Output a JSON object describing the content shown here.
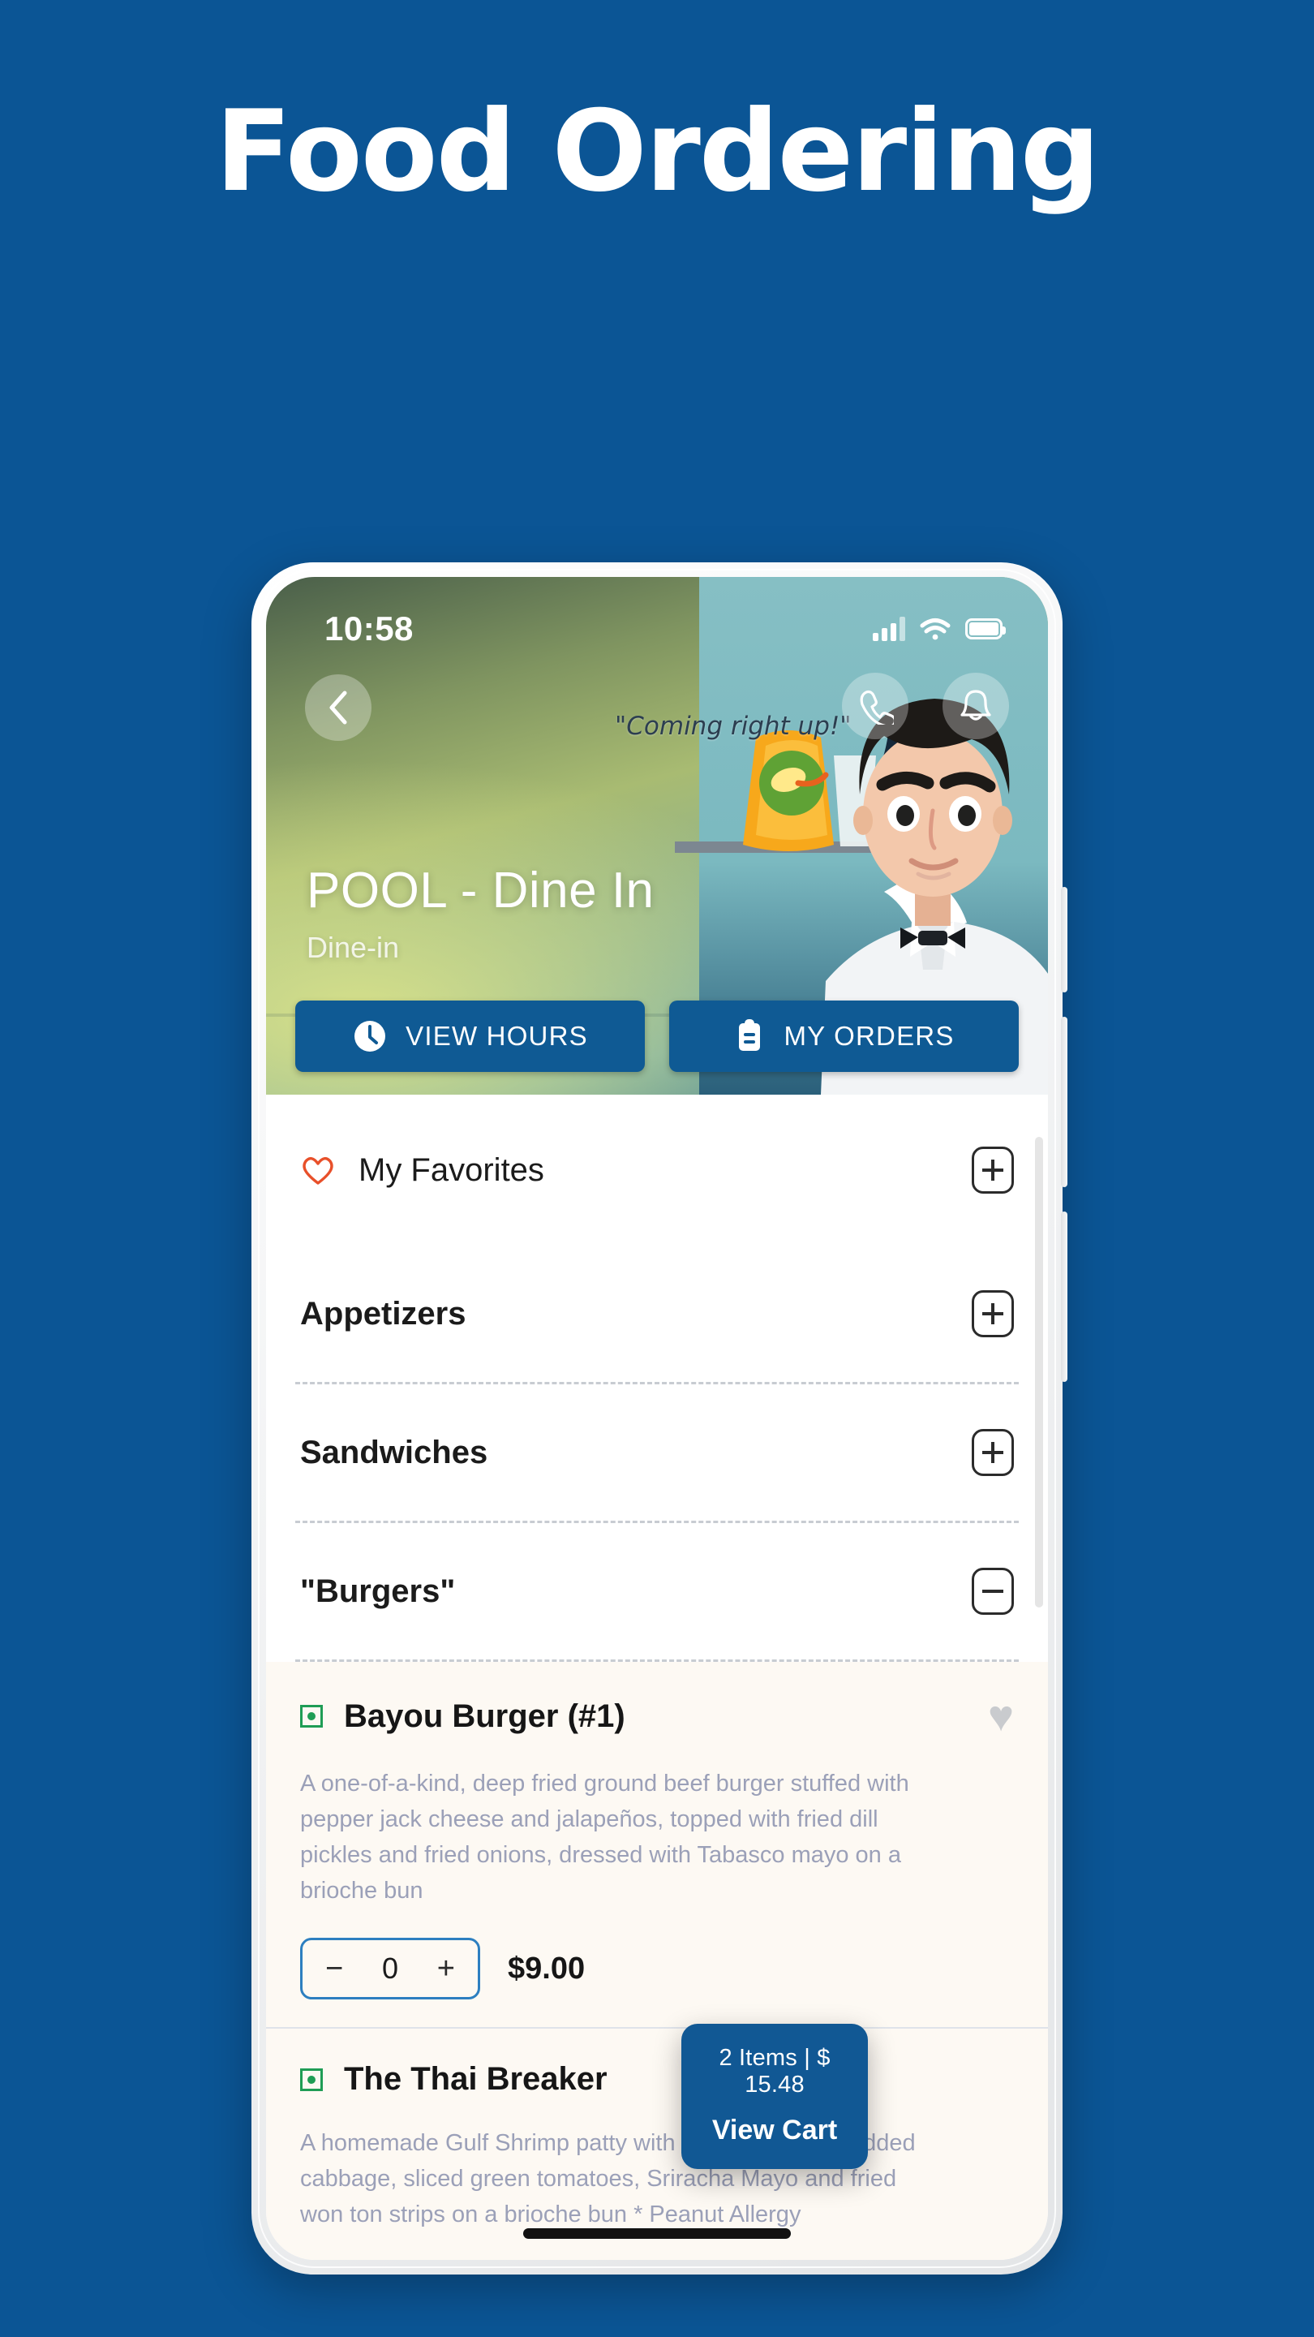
{
  "poster": {
    "title": "Food Ordering",
    "background_color": "#0b5595"
  },
  "phone": {
    "status_bar": {
      "time": "10:58",
      "signal_icon": "signal-bars-icon",
      "wifi_icon": "wifi-icon",
      "battery_icon": "battery-icon"
    }
  },
  "hero": {
    "back_icon": "chevron-left-icon",
    "phone_icon": "phone-icon",
    "bell_icon": "bell-icon",
    "speech_bubble": "\"Coming right up!\"",
    "title": "POOL - Dine In",
    "subtitle": "Dine-in",
    "buttons": [
      {
        "label": "VIEW HOURS",
        "icon": "clock-icon"
      },
      {
        "label": "MY ORDERS",
        "icon": "clipboard-icon"
      }
    ],
    "button_color": "#0f5a94"
  },
  "categories": [
    {
      "label": "My Favorites",
      "icon": "heart-outline-icon",
      "icon_color": "#e8502a",
      "bold": false,
      "state": "collapsed",
      "toggle": "plus"
    },
    {
      "label": "Appetizers",
      "icon": null,
      "bold": true,
      "state": "collapsed",
      "toggle": "plus"
    },
    {
      "label": "Sandwiches",
      "icon": null,
      "bold": true,
      "state": "collapsed",
      "toggle": "plus"
    },
    {
      "label": "\"Burgers\"",
      "icon": null,
      "bold": true,
      "state": "expanded",
      "toggle": "minus"
    }
  ],
  "items": [
    {
      "name": "Bayou Burger (#1)",
      "veg_mark": "veg-indicator-icon",
      "favorite_icon": "heart-filled-icon",
      "description": "A one-of-a-kind, deep fried ground beef burger stuffed with pepper jack cheese and jalapeños, topped with fried dill pickles and fried onions, dressed with Tabasco mayo on a brioche bun",
      "quantity": "0",
      "decrement_label": "−",
      "increment_label": "+",
      "price": "$9.00"
    },
    {
      "name": "The Thai Breaker",
      "veg_mark": "veg-indicator-icon",
      "favorite_icon": "heart-filled-icon",
      "description": "A homemade Gulf Shrimp patty with Thai spices, Shredded cabbage, sliced green tomatoes, Sriracha Mayo and fried won ton strips on a brioche bun * Peanut Allergy"
    }
  ],
  "cart": {
    "summary": "2 Items | $ 15.48",
    "action": "View Cart",
    "color": "#115894"
  }
}
